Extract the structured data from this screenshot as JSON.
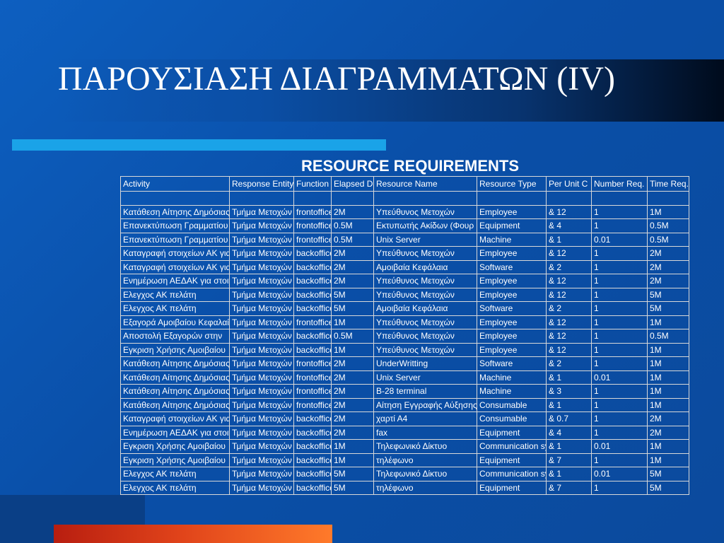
{
  "slide": {
    "title": "ΠΑΡΟΥΣΙΑΣΗ ΔΙΑΓΡΑΜΜΑΤΩΝ (IV)",
    "table_title": "RESOURCE REQUIREMENTS"
  },
  "colors": {
    "background": "#0b53ad",
    "accent_bar": "#1aa3e8",
    "bottom_bar": "#e0431a"
  },
  "table": {
    "headers": [
      "Activity",
      "Response Entity",
      "Function",
      "Elapsed D",
      "Resource Name",
      "Resource Type",
      "Per Unit C",
      "Number Req.",
      "Time Req."
    ],
    "rows": [
      [
        "",
        "",
        "",
        "",
        "",
        "",
        "",
        "",
        ""
      ],
      [
        "Κατάθεση Αίτησης Δημόσιας",
        "Τμήμα Μετοχών",
        "frontoffice",
        "2M",
        "Υπεύθυνος Μετοχών",
        "Employee",
        "&   12",
        "1",
        "1M"
      ],
      [
        "Επανεκτύπωση Γραμματίου",
        "Τμήμα Μετοχών",
        "frontoffice",
        "0.5M",
        "Εκτυπωτής Ακίδων (Φουρ",
        "Equipment",
        "&   4",
        "1",
        "0.5M"
      ],
      [
        "Επανεκτύπωση Γραμματίου",
        "Τμήμα Μετοχών",
        "frontoffice",
        "0.5M",
        "Unix Server",
        "Machine",
        "&   1",
        "0.01",
        "0.5M"
      ],
      [
        "Καταγραφή στοιχείων ΑΚ για",
        "Τμήμα Μετοχών",
        "backoffice",
        "2M",
        "Υπεύθυνος Μετοχών",
        "Employee",
        "&   12",
        "1",
        "2M"
      ],
      [
        "Καταγραφή στοιχείων ΑΚ για",
        "Τμήμα Μετοχών",
        "backoffice",
        "2M",
        "Αμοιβαία Κεφάλαια",
        "Software",
        "&   2",
        "1",
        "2M"
      ],
      [
        "Ενημέρωση ΑΕΔΑΚ για στοιχεία",
        "Τμήμα Μετοχών",
        "backoffice",
        "2M",
        "Υπεύθυνος Μετοχών",
        "Employee",
        "&   12",
        "1",
        "2M"
      ],
      [
        "Ελεγχος ΑΚ πελάτη",
        "Τμήμα Μετοχών",
        "backoffice",
        "5M",
        "Υπεύθυνος Μετοχών",
        "Employee",
        "&   12",
        "1",
        "5M"
      ],
      [
        "Ελεγχος ΑΚ πελάτη",
        "Τμήμα Μετοχών",
        "backoffice",
        "5M",
        "Αμοιβαία Κεφάλαια",
        "Software",
        "&   2",
        "1",
        "5M"
      ],
      [
        "Εξαγορά Αμοιβαίου Κεφαλαίου",
        "Τμήμα Μετοχών",
        "frontoffice",
        "1M",
        "Υπεύθυνος Μετοχών",
        "Employee",
        "&   12",
        "1",
        "1M"
      ],
      [
        "Αποστολή Εξαγορών στην",
        "Τμήμα Μετοχών",
        "backoffice",
        "0.5M",
        "Υπεύθυνος Μετοχών",
        "Employee",
        "&   12",
        "1",
        "0.5M"
      ],
      [
        "Εγκριση Χρήσης Αμοιβαίου",
        "Τμήμα Μετοχών",
        "backoffice",
        "1M",
        "Υπεύθυνος Μετοχών",
        "Employee",
        "&   12",
        "1",
        "1M"
      ],
      [
        "Κατάθεση Αίτησης Δημόσιας",
        "Τμήμα Μετοχών",
        "frontoffice",
        "2M",
        "UnderWritting",
        "Software",
        "&   2",
        "1",
        "1M"
      ],
      [
        "Κατάθεση Αίτησης Δημόσιας",
        "Τμήμα Μετοχών",
        "frontoffice",
        "2M",
        "Unix Server",
        "Machine",
        "&   1",
        "0.01",
        "1M"
      ],
      [
        "Κατάθεση Αίτησης Δημόσιας",
        "Τμήμα Μετοχών",
        "frontoffice",
        "2M",
        "B-28 terminal",
        "Machine",
        "&   3",
        "1",
        "1M"
      ],
      [
        "Κατάθεση Αίτησης Δημόσιας",
        "Τμήμα Μετοχών",
        "frontoffice",
        "2M",
        "Αίτηση Εγγραφής Αύξησης",
        "Consumable",
        "&   1",
        "1",
        "1M"
      ],
      [
        "Καταγραφή στοιχείων ΑΚ για",
        "Τμήμα Μετοχών",
        "backoffice",
        "2M",
        "χαρτί Α4",
        "Consumable",
        "&   0.7",
        "1",
        "2M"
      ],
      [
        "Ενημέρωση ΑΕΔΑΚ για στοιχεία",
        "Τμήμα Μετοχών",
        "backoffice",
        "2M",
        "fax",
        "Equipment",
        "&   4",
        "1",
        "2M"
      ],
      [
        "Εγκριση Χρήσης Αμοιβαίου",
        "Τμήμα Μετοχών",
        "backoffice",
        "1M",
        "Τηλεφωνικό Δίκτυο",
        "Communication system",
        "&   1",
        "0.01",
        "1M"
      ],
      [
        "Εγκριση Χρήσης Αμοιβαίου",
        "Τμήμα Μετοχών",
        "backoffice",
        "1M",
        "τηλέφωνο",
        "Equipment",
        "&   7",
        "1",
        "1M"
      ],
      [
        "Ελεγχος ΑΚ πελάτη",
        "Τμήμα Μετοχών",
        "backoffice",
        "5M",
        "Τηλεφωνικό Δίκτυο",
        "Communication system",
        "&   1",
        "0.01",
        "5M"
      ],
      [
        "Ελεγχος ΑΚ πελάτη",
        "Τμήμα Μετοχών",
        "backoffice",
        "5M",
        "τηλέφωνο",
        "Equipment",
        "&   7",
        "1",
        "5M"
      ]
    ]
  }
}
